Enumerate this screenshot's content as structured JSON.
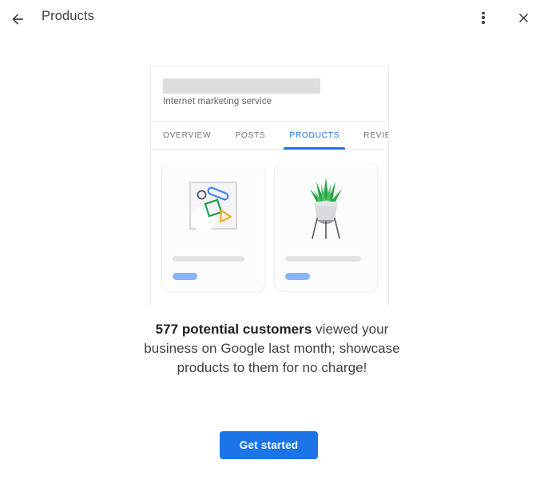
{
  "appbar": {
    "back_icon": "arrow-back-icon",
    "title": "Products",
    "overflow_icon": "more-vert-icon",
    "close_icon": "close-icon"
  },
  "illustration": {
    "business": {
      "name_redacted": "",
      "category": "Internet marketing service"
    },
    "tabs": [
      {
        "label": "OVERVIEW",
        "active": false
      },
      {
        "label": "POSTS",
        "active": false
      },
      {
        "label": "PRODUCTS",
        "active": true
      },
      {
        "label": "REVIEWS",
        "active": false
      }
    ],
    "products": [
      {
        "media_icon": "image-placeholder-icon",
        "title_placeholder": "",
        "price_placeholder": ""
      },
      {
        "media_icon": "potted-plant-icon",
        "title_placeholder": "",
        "price_placeholder": ""
      }
    ]
  },
  "message": {
    "highlight": "577 potential customers",
    "rest": " viewed your business on Google last month; showcase products to them for no charge!"
  },
  "cta": {
    "label": "Get started"
  },
  "colors": {
    "accent_blue": "#1a73e8",
    "button_blue": "#1b74e8",
    "pill_blue": "#8ab4f8",
    "text_primary": "#3c4043",
    "text_secondary": "#5f6368",
    "placeholder_gray": "#dddddd",
    "divider": "#e8eaed"
  }
}
